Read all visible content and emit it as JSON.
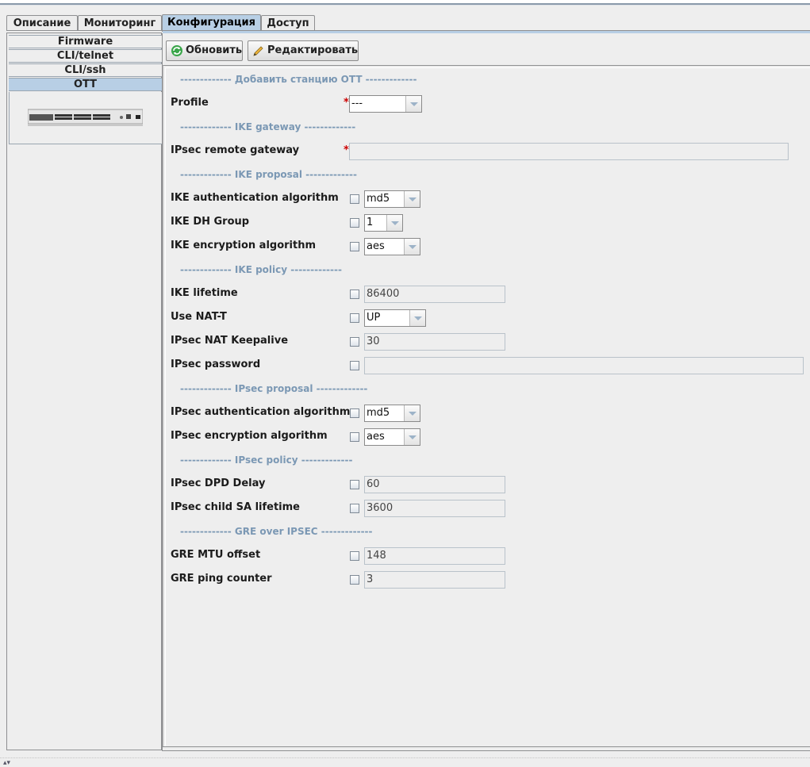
{
  "tabs": [
    {
      "label": "Описание",
      "active": false
    },
    {
      "label": "Мониторинг",
      "active": false
    },
    {
      "label": "Конфигурация",
      "active": true
    },
    {
      "label": "Доступ",
      "active": false
    }
  ],
  "sidebar": {
    "items": [
      {
        "label": "Firmware",
        "active": false
      },
      {
        "label": "CLI/telnet",
        "active": false
      },
      {
        "label": "CLI/ssh",
        "active": false
      },
      {
        "label": "OTT",
        "active": true
      }
    ],
    "device_image": "network-switch-icon"
  },
  "toolbar": {
    "refresh_label": "Обновить",
    "refresh_icon": "refresh-icon",
    "edit_label": "Редактировать",
    "edit_icon": "pencil-icon"
  },
  "form": {
    "sections": {
      "add_station": "------------- Добавить станцию OTT -------------",
      "ike_gateway": "------------- IKE gateway -------------",
      "ike_proposal": "------------- IKE proposal -------------",
      "ike_policy": "------------- IKE policy -------------",
      "ipsec_proposal": "------------- IPsec proposal -------------",
      "ipsec_policy": "------------- IPsec policy -------------",
      "gre_over_ipsec": "------------- GRE over IPSEC -------------"
    },
    "required_mark": "*",
    "profile": {
      "label": "Profile",
      "value": "---"
    },
    "ipsec_remote_gateway": {
      "label": "IPsec remote gateway",
      "value": ""
    },
    "ike_auth_algorithm": {
      "label": "IKE authentication algorithm",
      "value": "md5"
    },
    "ike_dh_group": {
      "label": "IKE DH Group",
      "value": "1"
    },
    "ike_encryption_algorithm": {
      "label": "IKE encryption algorithm",
      "value": "aes"
    },
    "ike_lifetime": {
      "label": "IKE lifetime",
      "value": "86400"
    },
    "use_nat_t": {
      "label": "Use NAT-T",
      "value": "UP"
    },
    "ipsec_nat_keepalive": {
      "label": "IPsec NAT Keepalive",
      "value": "30"
    },
    "ipsec_password": {
      "label": "IPsec password",
      "value": ""
    },
    "ipsec_auth_algorithm": {
      "label": "IPsec authentication algorithm",
      "value": "md5"
    },
    "ipsec_encryption_algorithm": {
      "label": "IPsec encryption algorithm",
      "value": "aes"
    },
    "ipsec_dpd_delay": {
      "label": "IPsec DPD Delay",
      "value": "60"
    },
    "ipsec_child_sa_lifetime": {
      "label": "IPsec child SA lifetime",
      "value": "3600"
    },
    "gre_mtu_offset": {
      "label": "GRE MTU offset",
      "value": "148"
    },
    "gre_ping_counter": {
      "label": "GRE ping counter",
      "value": "3"
    }
  },
  "colors": {
    "active_tab": "#b8cfe5",
    "section_header": "#7b98b4",
    "required": "#cc0000"
  }
}
